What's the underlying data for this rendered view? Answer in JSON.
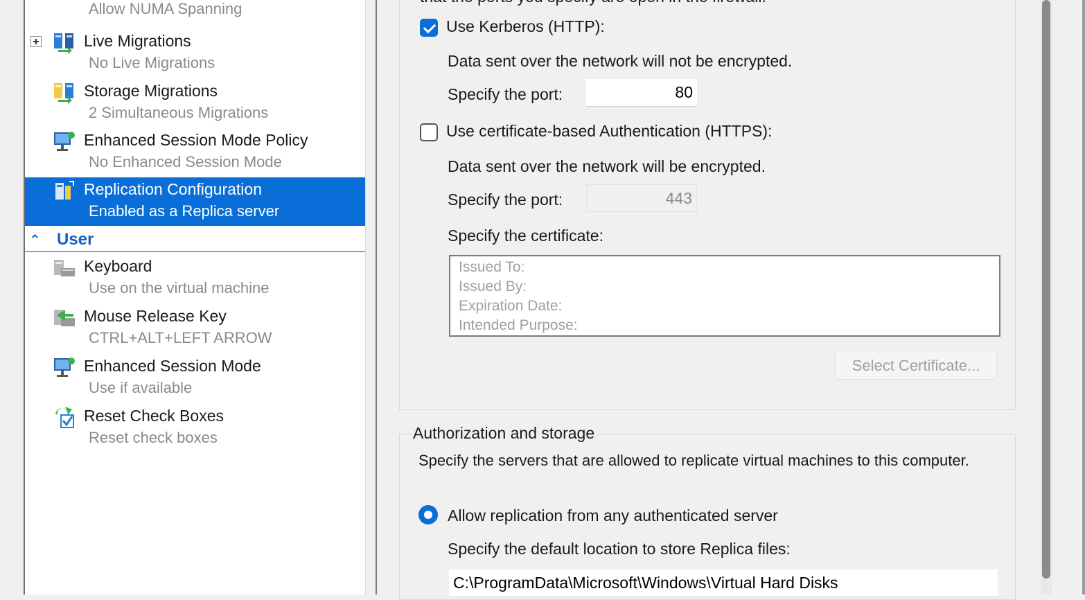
{
  "tree": {
    "items": [
      {
        "title": "",
        "sub": "Allow NUMA Spanning",
        "icon": "numa-icon"
      },
      {
        "title": "Live Migrations",
        "sub": "No Live Migrations",
        "icon": "live-migration-icon"
      },
      {
        "title": "Storage Migrations",
        "sub": "2 Simultaneous Migrations",
        "icon": "storage-migration-icon"
      },
      {
        "title": "Enhanced Session Mode Policy",
        "sub": "No Enhanced Session Mode",
        "icon": "enhanced-session-icon"
      },
      {
        "title": "Replication Configuration",
        "sub": "Enabled as a Replica server",
        "icon": "replication-icon"
      },
      {
        "title": "Keyboard",
        "sub": "Use on the virtual machine",
        "icon": "keyboard-icon"
      },
      {
        "title": "Mouse Release Key",
        "sub": "CTRL+ALT+LEFT ARROW",
        "icon": "mouse-icon"
      },
      {
        "title": "Enhanced Session Mode",
        "sub": "Use if available",
        "icon": "enhanced-session-icon"
      },
      {
        "title": "Reset Check Boxes",
        "sub": "Reset check boxes",
        "icon": "reset-checkbox-icon"
      }
    ],
    "section_user": "User"
  },
  "auth": {
    "clipped_text": "that the ports you specify are open in the firewall.",
    "kerberos_label": "Use Kerberos (HTTP):",
    "kerberos_checked": true,
    "kerberos_note": "Data sent over the network will not be encrypted.",
    "kerberos_port_label": "Specify the port:",
    "kerberos_port": "80",
    "cert_label": "Use certificate-based Authentication (HTTPS):",
    "cert_checked": false,
    "cert_note": "Data sent over the network will be encrypted.",
    "cert_port_label": "Specify the port:",
    "cert_port": "443",
    "specify_cert_label": "Specify the certificate:",
    "cert_fields": [
      "Issued To:",
      "Issued By:",
      "Expiration Date:",
      "Intended Purpose:"
    ],
    "select_cert_button": "Select Certificate..."
  },
  "storage": {
    "title": "Authorization and storage",
    "description": "Specify the servers that are allowed to replicate virtual machines to this computer.",
    "allow_any_label": "Allow replication from any authenticated server",
    "default_location_label": "Specify the default location to store Replica files:",
    "default_location": "C:\\ProgramData\\Microsoft\\Windows\\Virtual Hard Disks"
  },
  "colors": {
    "accent": "#0a6ed9",
    "selected_bg": "#0a6ed9",
    "section_header": "#1a5fc2"
  }
}
